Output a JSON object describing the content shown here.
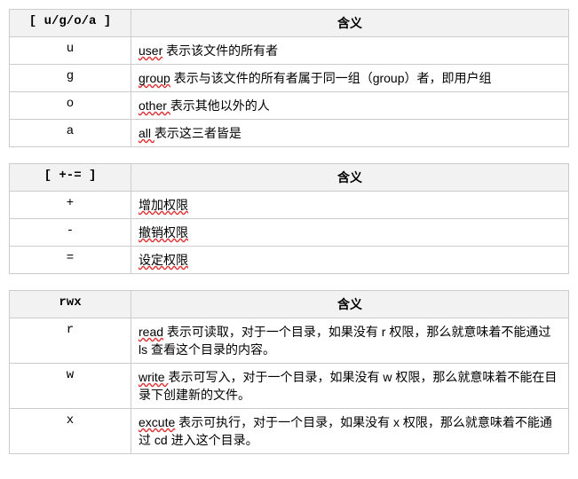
{
  "tables": [
    {
      "header_key": "[ u/g/o/a ]",
      "header_meaning": "含义",
      "rows": [
        {
          "key": "u",
          "meaning_pre": "user",
          "meaning_rest": " 表示该文件的所有者"
        },
        {
          "key": "g",
          "meaning_pre": "group",
          "meaning_rest": " 表示与该文件的所有者属于同一组（group）者，即用户组"
        },
        {
          "key": "o",
          "meaning_pre": "other ",
          "meaning_rest": "表示其他以外的人"
        },
        {
          "key": "a",
          "meaning_pre": "all ",
          "meaning_rest": "表示这三者皆是"
        }
      ]
    },
    {
      "header_key": "[ +-= ]",
      "header_meaning": "含义",
      "rows": [
        {
          "key": "+",
          "meaning_pre": "增加权限",
          "meaning_rest": ""
        },
        {
          "key": "-",
          "meaning_pre": "撤销权限",
          "meaning_rest": ""
        },
        {
          "key": "=",
          "meaning_pre": "设定权限",
          "meaning_rest": ""
        }
      ]
    },
    {
      "header_key": "rwx",
      "header_meaning": "含义",
      "rows": [
        {
          "key": "r",
          "meaning_pre": "read",
          "meaning_rest": " 表示可读取，对于一个目录，如果没有 r 权限，那么就意味着不能通过 ls 查看这个目录的内容。"
        },
        {
          "key": "w",
          "meaning_pre": "write ",
          "meaning_rest": "表示可写入，对于一个目录，如果没有 w 权限，那么就意味着不能在目录下创建新的文件。"
        },
        {
          "key": "x",
          "meaning_pre": "excute",
          "meaning_rest": " 表示可执行，对于一个目录，如果没有 x 权限，那么就意味着不能通过 cd 进入这个目录。"
        }
      ]
    }
  ]
}
